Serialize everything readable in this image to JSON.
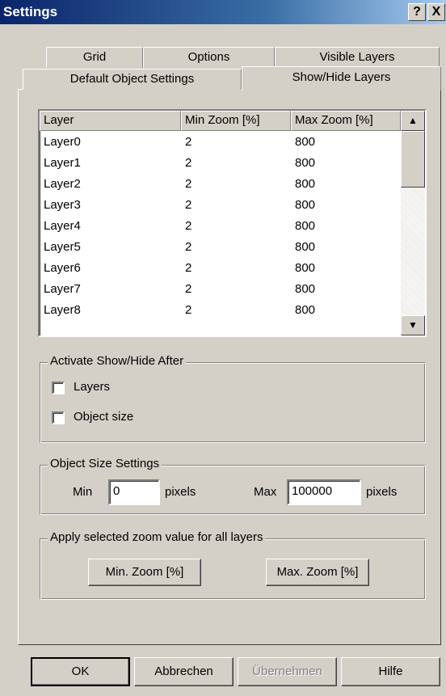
{
  "window": {
    "title": "Settings",
    "help_glyph": "?",
    "close_glyph": "X"
  },
  "tabs": {
    "row1": [
      "Grid",
      "Options",
      "Visible Layers"
    ],
    "row2": [
      "Default Object Settings",
      "Show/Hide Layers"
    ],
    "active": "Show/Hide Layers"
  },
  "layers_table": {
    "headers": [
      "Layer",
      "Min Zoom [%]",
      "Max Zoom [%]"
    ],
    "rows": [
      [
        "Layer0",
        "2",
        "800"
      ],
      [
        "Layer1",
        "2",
        "800"
      ],
      [
        "Layer2",
        "2",
        "800"
      ],
      [
        "Layer3",
        "2",
        "800"
      ],
      [
        "Layer4",
        "2",
        "800"
      ],
      [
        "Layer5",
        "2",
        "800"
      ],
      [
        "Layer6",
        "2",
        "800"
      ],
      [
        "Layer7",
        "2",
        "800"
      ],
      [
        "Layer8",
        "2",
        "800"
      ]
    ],
    "scroll_up_glyph": "▲",
    "scroll_down_glyph": "▼"
  },
  "activate_group": {
    "title": "Activate Show/Hide After",
    "layers_label": "Layers",
    "layers_checked": false,
    "object_size_label": "Object size",
    "object_size_checked": false
  },
  "object_size_group": {
    "title": "Object Size Settings",
    "min_label": "Min",
    "min_value": "0",
    "min_unit": "pixels",
    "max_label": "Max",
    "max_value": "100000",
    "max_unit": "pixels"
  },
  "zoom_group": {
    "title": "Apply selected zoom value for all layers",
    "min_button": "Min. Zoom [%]",
    "max_button": "Max. Zoom [%]"
  },
  "footer": {
    "ok": "OK",
    "cancel": "Abbrechen",
    "apply": "Übernehmen",
    "help": "Hilfe"
  }
}
